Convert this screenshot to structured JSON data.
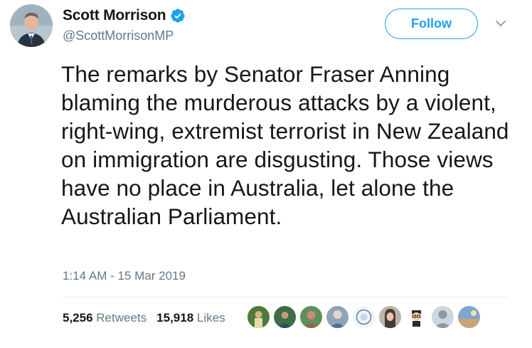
{
  "author": {
    "display_name": "Scott Morrison",
    "handle": "@ScottMorrisonMP",
    "verified": true
  },
  "follow_label": "Follow",
  "tweet": {
    "text": "The remarks by Senator Fraser Anning blaming the murderous attacks by a violent, right-wing, extremist terrorist in New Zealand on immigration are disgusting. Those views have no place in Australia, let alone the Australian Parliament.",
    "timestamp": "1:14 AM - 15 Mar 2019"
  },
  "stats": {
    "retweets_count": "5,256",
    "retweets_label": "Retweets",
    "likes_count": "15,918",
    "likes_label": "Likes"
  },
  "colors": {
    "accent": "#1da1f2",
    "text": "#14171a",
    "muted": "#657786",
    "divider": "#e6ecf0"
  },
  "icons": {
    "verified": "verified-badge-icon",
    "more": "chevron-down-icon"
  }
}
